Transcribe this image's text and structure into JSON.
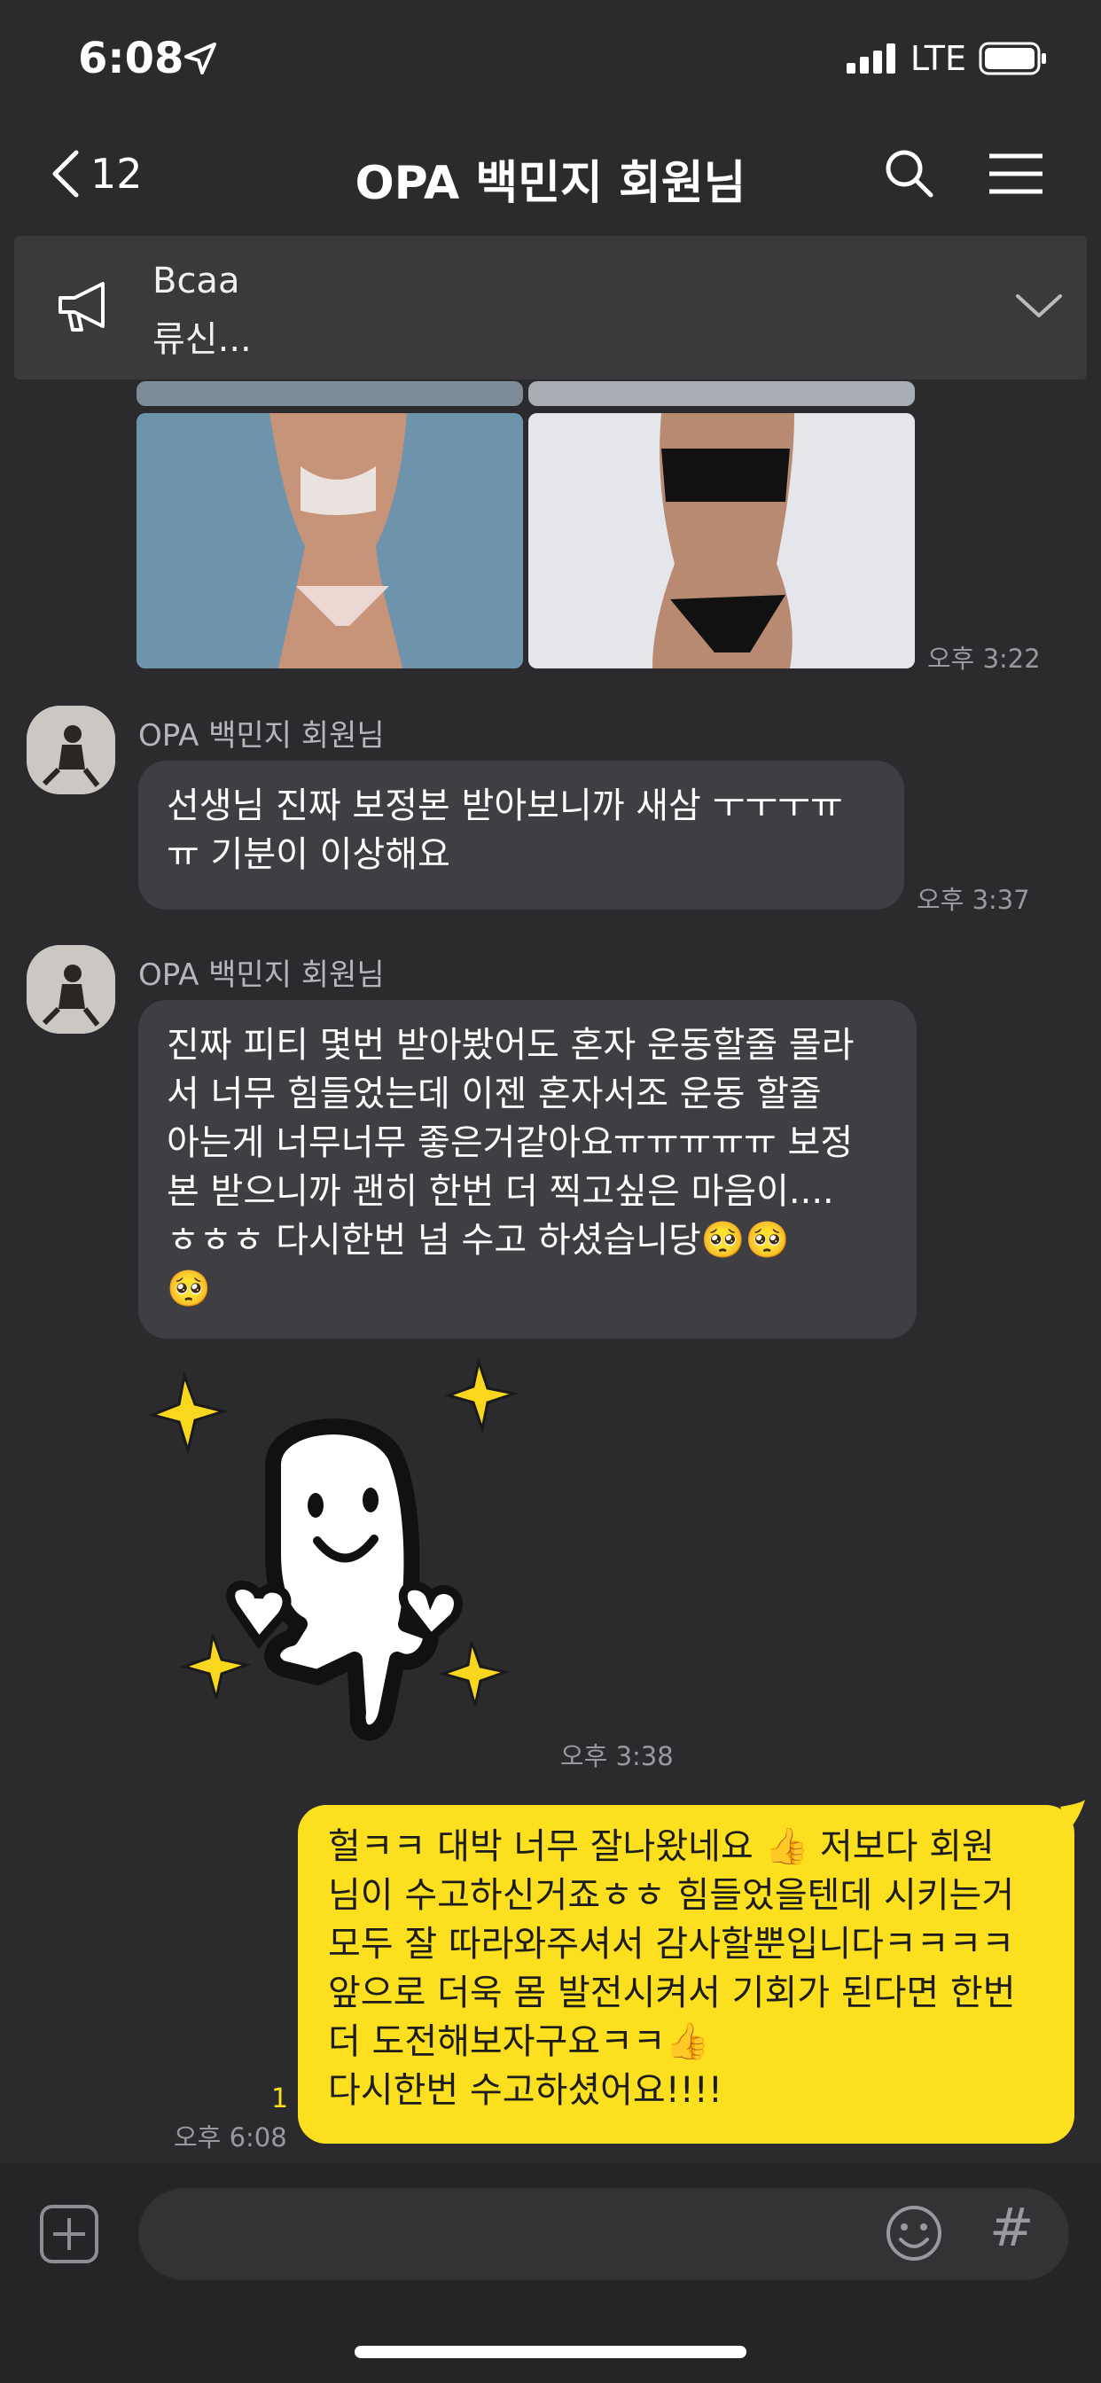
{
  "status": {
    "time": "6:08",
    "network": "LTE"
  },
  "header": {
    "back_count": "12",
    "title": "OPA 백민지 회원님"
  },
  "notice": {
    "line1": "Bcaa",
    "line2": "류신..."
  },
  "messages": {
    "images_time": "오후 3:22",
    "m1": {
      "sender": "OPA 백민지 회원님",
      "text": "선생님 진짜 보정본 받아보니까 새삼 ㅜㅜㅜㅠ\nㅠ 기분이 이상해요",
      "time": "오후 3:37"
    },
    "m2": {
      "sender": "OPA 백민지 회원님",
      "text": "진짜 피티 몇번 받아봤어도 혼자 운동할줄 몰라\n서 너무 힘들었는데 이젠 혼자서조 운동 할줄\n아는게 너무너무 좋은거같아요ㅠㅠㅠㅠㅠ 보정\n본 받으니까 괜히 한번 더 찍고싶은 마음이....\nㅎㅎㅎ 다시한번 넘 수고 하셨습니당🥺🥺\n🥺",
      "time": "오후 3:38"
    },
    "sticker_time": "오후 3:38",
    "out": {
      "unread": "1",
      "time": "오후 6:08",
      "text": "헐ㅋㅋ 대박 너무 잘나왔네요 👍 저보다 회원\n님이 수고하신거죠ㅎㅎ 힘들었을텐데 시키는거\n모두 잘 따라와주셔서 감사할뿐입니다ㅋㅋㅋㅋ\n앞으로 더욱 몸 발전시켜서 기회가 된다면 한번\n더 도전해보자구요ㅋㅋ👍\n다시한번 수고하셨어요!!!!"
    }
  },
  "input": {
    "hash": "#"
  },
  "colors": {
    "background": "#2b2b2d",
    "bubble_in": "#3f3f43",
    "bubble_out": "#fcdf1e"
  }
}
